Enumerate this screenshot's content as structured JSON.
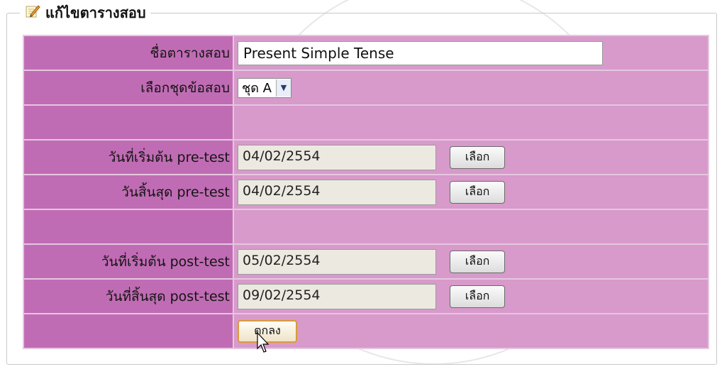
{
  "legend": {
    "title": "แก้ไขตารางสอบ",
    "icon": "pencil-icon"
  },
  "fields": {
    "exam_name": {
      "label": "ชื่อตารางสอบ",
      "value": "Present Simple Tense"
    },
    "exam_set": {
      "label": "เลือกชุดข้อสอบ",
      "selected": "ชุด A"
    },
    "pre_start": {
      "label": "วันที่เริ่มต้น pre-test",
      "value": "04/02/2554",
      "button": "เลือก"
    },
    "pre_end": {
      "label": "วันสิ้นสุด pre-test",
      "value": "04/02/2554",
      "button": "เลือก"
    },
    "post_start": {
      "label": "วันที่เริ่มต้น post-test",
      "value": "05/02/2554",
      "button": "เลือก"
    },
    "post_end": {
      "label": "วันที่สิ้นสุด post-test",
      "value": "09/02/2554",
      "button": "เลือก"
    }
  },
  "submit_label": "ตกลง",
  "colors": {
    "label_bg": "#c06cb4",
    "field_bg": "#d79acb",
    "border": "#e6c7df"
  }
}
